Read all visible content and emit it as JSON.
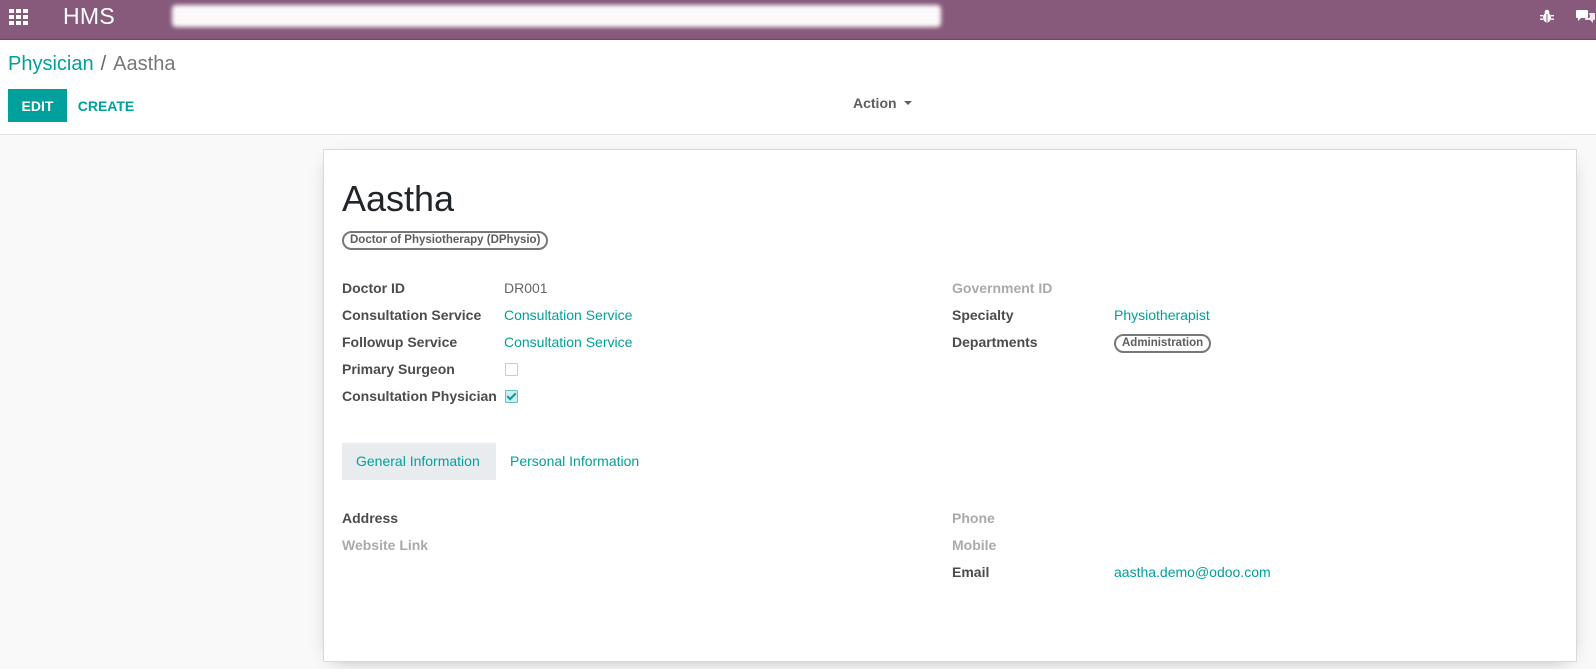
{
  "navbar": {
    "apps_icon": "grid-icon",
    "brand": "HMS",
    "debug_icon": "bug-icon",
    "chat_icon": "chat-icon",
    "color": "#875a7b"
  },
  "breadcrumb": {
    "parent": "Physician",
    "separator": "/",
    "current": "Aastha"
  },
  "buttons": {
    "edit": "EDIT",
    "create": "CREATE",
    "action": "Action"
  },
  "form": {
    "name": "Aastha",
    "degree_tag": "Doctor of Physiotherapy (DPhysio)",
    "left_fields": {
      "doctor_id": {
        "label": "Doctor ID",
        "value": "DR001"
      },
      "consultation_service": {
        "label": "Consultation Service",
        "value": "Consultation Service"
      },
      "followup_service": {
        "label": "Followup Service",
        "value": "Consultation Service"
      },
      "primary_surgeon": {
        "label": "Primary Surgeon",
        "checked": false
      },
      "consultation_physician": {
        "label": "Consultation Physician",
        "checked": true
      }
    },
    "right_fields": {
      "government_id": {
        "label": "Government ID",
        "value": ""
      },
      "specialty": {
        "label": "Specialty",
        "value": "Physiotherapist"
      },
      "departments": {
        "label": "Departments",
        "tags": [
          "Administration"
        ]
      }
    },
    "tabs": [
      {
        "label": "General Information",
        "active": true
      },
      {
        "label": "Personal Information",
        "active": false
      }
    ],
    "general": {
      "address": {
        "label": "Address",
        "value": ""
      },
      "website": {
        "label": "Website Link",
        "value": ""
      },
      "phone": {
        "label": "Phone",
        "value": ""
      },
      "mobile": {
        "label": "Mobile",
        "value": ""
      },
      "email": {
        "label": "Email",
        "value": "aastha.demo@odoo.com"
      }
    }
  },
  "colors": {
    "accent": "#00a09d",
    "navbar": "#875a7b"
  }
}
